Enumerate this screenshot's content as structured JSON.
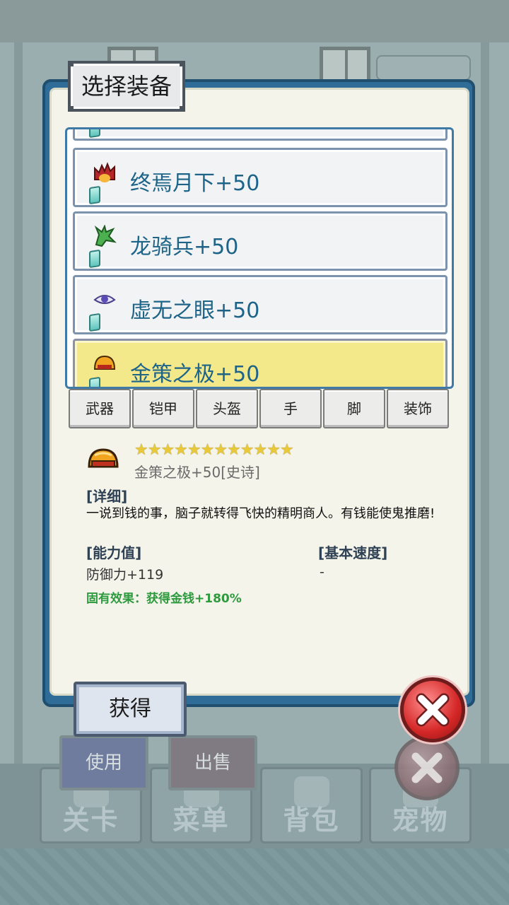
{
  "background": {
    "nav_tabs": [
      "关卡",
      "菜单",
      "背包",
      "宠物"
    ],
    "under_buttons": {
      "use": "使用",
      "sell": "出售"
    }
  },
  "dialog": {
    "title": "选择装备",
    "list_items": [
      {
        "label": "终焉月下+50",
        "icon": "flame-crown-icon",
        "selected": false
      },
      {
        "label": "龙骑兵+50",
        "icon": "green-dragon-icon",
        "selected": false
      },
      {
        "label": "虚无之眼+50",
        "icon": "purple-eye-icon",
        "selected": false
      },
      {
        "label": "金策之极+50",
        "icon": "gold-helmet-icon",
        "selected": true
      }
    ],
    "tabs": [
      "武器",
      "铠甲",
      "头盔",
      "手",
      "脚",
      "装饰"
    ],
    "detail": {
      "icon": "gold-helmet-icon",
      "stars": "★★★★★★★★★★★★",
      "name": "金策之极+50[史诗]",
      "section_detail": "[详细]",
      "description": "一说到钱的事，脑子就转得飞快的精明商人。有钱能使鬼推磨!",
      "section_ability": "[能力值]",
      "ability_value": "防御力+119",
      "section_speed": "[基本速度]",
      "speed_value": "-",
      "inherent_effect": "固有效果：获得金钱+180%"
    },
    "obtain_label": "获得"
  },
  "colors": {
    "panel_blue": "#2f6d98",
    "selected_row": "#f3e98a",
    "item_text": "#1d6488",
    "effect_green": "#2e9a3e",
    "close_red": "#d52727"
  }
}
